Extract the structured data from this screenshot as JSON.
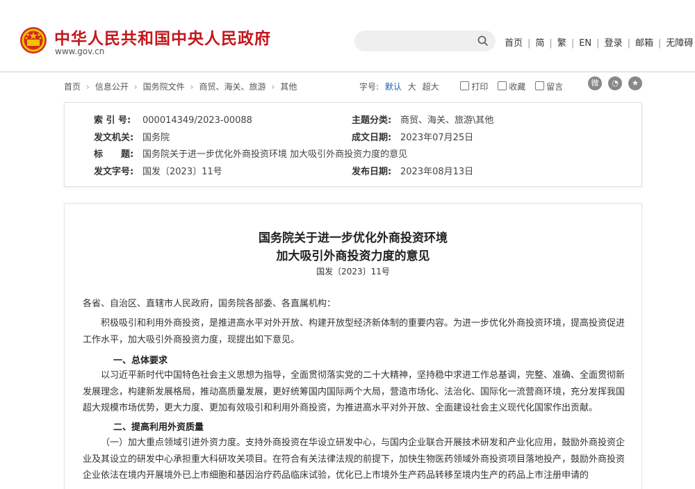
{
  "header": {
    "site_title": "中华人民共和国中央人民政府",
    "site_domain": "www.gov.cn",
    "brand_color": "#c4161c",
    "nav": [
      "首页",
      "简",
      "繁",
      "EN",
      "登录",
      "邮箱",
      "无障碍"
    ]
  },
  "breadcrumb": {
    "items": [
      "首页",
      "信息公开",
      "国务院文件",
      "商贸、海关、旅游",
      "其他"
    ]
  },
  "toolbar": {
    "font_label": "字号:",
    "font_default": "默认",
    "font_large": "大",
    "font_xlarge": "超大",
    "print": "打印",
    "favorite": "收藏",
    "comment": "留言",
    "share_icons": [
      "weibo-icon",
      "wechat-icon",
      "qzone-icon"
    ]
  },
  "info": {
    "index_label": "索 引 号:",
    "index_value": "000014349/2023-00088",
    "category_label": "主题分类:",
    "category_value": "商贸、海关、旅游\\其他",
    "issuer_label": "发文机关:",
    "issuer_value": "国务院",
    "created_label": "成文日期:",
    "created_value": "2023年07月25日",
    "title_label": "标　　题:",
    "title_value": "国务院关于进一步优化外商投资环境 加大吸引外商投资力度的意见",
    "docno_label": "发文字号:",
    "docno_value": "国发〔2023〕11号",
    "published_label": "发布日期:",
    "published_value": "2023年08月13日"
  },
  "article": {
    "title_line1": "国务院关于进一步优化外商投资环境",
    "title_line2": "加大吸引外商投资力度的意见",
    "doc_number": "国发〔2023〕11号",
    "salutation": "各省、自治区、直辖市人民政府，国务院各部委、各直属机构：",
    "intro": "积极吸引和利用外商投资，是推进高水平对外开放、构建开放型经济新体制的重要内容。为进一步优化外商投资环境，提高投资促进工作水平，加大吸引外商投资力度，现提出如下意见。",
    "section1_heading": "一、总体要求",
    "section1_text": "以习近平新时代中国特色社会主义思想为指导，全面贯彻落实党的二十大精神，坚持稳中求进工作总基调，完整、准确、全面贯彻新发展理念，构建新发展格局，推动高质量发展，更好统筹国内国际两个大局，营造市场化、法治化、国际化一流营商环境，充分发挥我国超大规模市场优势，更大力度、更加有效吸引和利用外商投资，为推进高水平对外开放、全面建设社会主义现代化国家作出贡献。",
    "section2_heading": "二、提高利用外资质量",
    "section2_text": "（一）加大重点领域引进外资力度。支持外商投资在华设立研发中心，与国内企业联合开展技术研发和产业化应用，鼓励外商投资企业及其设立的研发中心承担重大科研攻关项目。在符合有关法律法规的前提下，加快生物医药领域外商投资项目落地投产，鼓励外商投资企业依法在境内开展境外已上市细胞和基因治疗药品临床试验，优化已上市境外生产药品转移至境内生产的药品上市注册申请的"
  }
}
